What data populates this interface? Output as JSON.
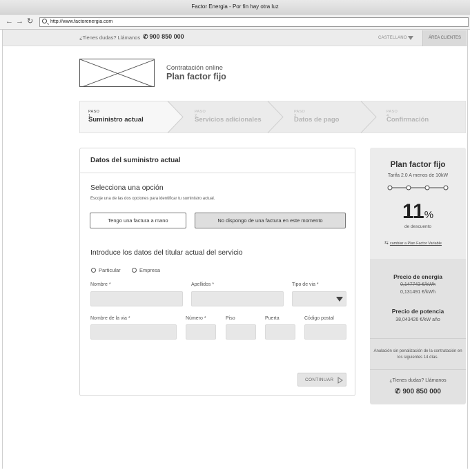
{
  "window": {
    "title": "Factor Energia - Por fin hay otra luz"
  },
  "browser": {
    "url": "http://www.factorenergia.com",
    "back_icon": "←",
    "forward_icon": "→",
    "reload_icon": "↻"
  },
  "topbar": {
    "help_text": "¿Tienes dudas? Llámanos",
    "phone": "900 850 000",
    "language": "CASTELLANO",
    "area_clientes": "ÁREA CLIENTES"
  },
  "header": {
    "subtitle": "Contratación online",
    "title": "Plan factor fijo"
  },
  "steps": [
    {
      "number": "PASO 1",
      "label": "Suministro actual",
      "active": true
    },
    {
      "number": "PASO 2",
      "label": "Servicios adicionales",
      "active": false
    },
    {
      "number": "PASO 3",
      "label": "Datos de pago",
      "active": false
    },
    {
      "number": "PASO 4",
      "label": "Confirmación",
      "active": false
    }
  ],
  "form": {
    "card_title": "Datos del suministro actual",
    "select_title": "Selecciona una opción",
    "select_desc": "Escoje una de las dos opciones para identificar tu suministro actual.",
    "option1": "Tengo una factura a mano",
    "option2": "No dispongo de una factura en este momento",
    "holder_title": "Introduce los datos del titular actual del servicio",
    "radio_particular": "Particular",
    "radio_empresa": "Empresa",
    "labels": {
      "nombre": "Nombre *",
      "apellidos": "Apellidos *",
      "tipo_via": "Tipo de via *",
      "nombre_via": "Nombre de la via *",
      "numero": "Número *",
      "piso": "Piso",
      "puerta": "Puerta",
      "codigo_postal": "Código postal"
    },
    "continue": "CONTINUAR"
  },
  "sidebar": {
    "plan_title": "Plan factor fijo",
    "plan_sub": "Tarifa 2.0 A menos de 10kW",
    "discount_value": "11",
    "discount_unit": "%",
    "discount_label": "de descuento",
    "change_link": "cambiar a Plan Factor Variable",
    "energy_title": "Precio de energía",
    "energy_old": "0,147743 €/kWh",
    "energy_new": "0,131491 €/kWh",
    "power_title": "Precio de potencia",
    "power_value": "38,043426 €/kW año",
    "note": "Anulación sin penalización de la contratación en los siguientes 14 días.",
    "help_text": "¿Tienes dudas? Llámanos",
    "phone": "900 850 000"
  }
}
